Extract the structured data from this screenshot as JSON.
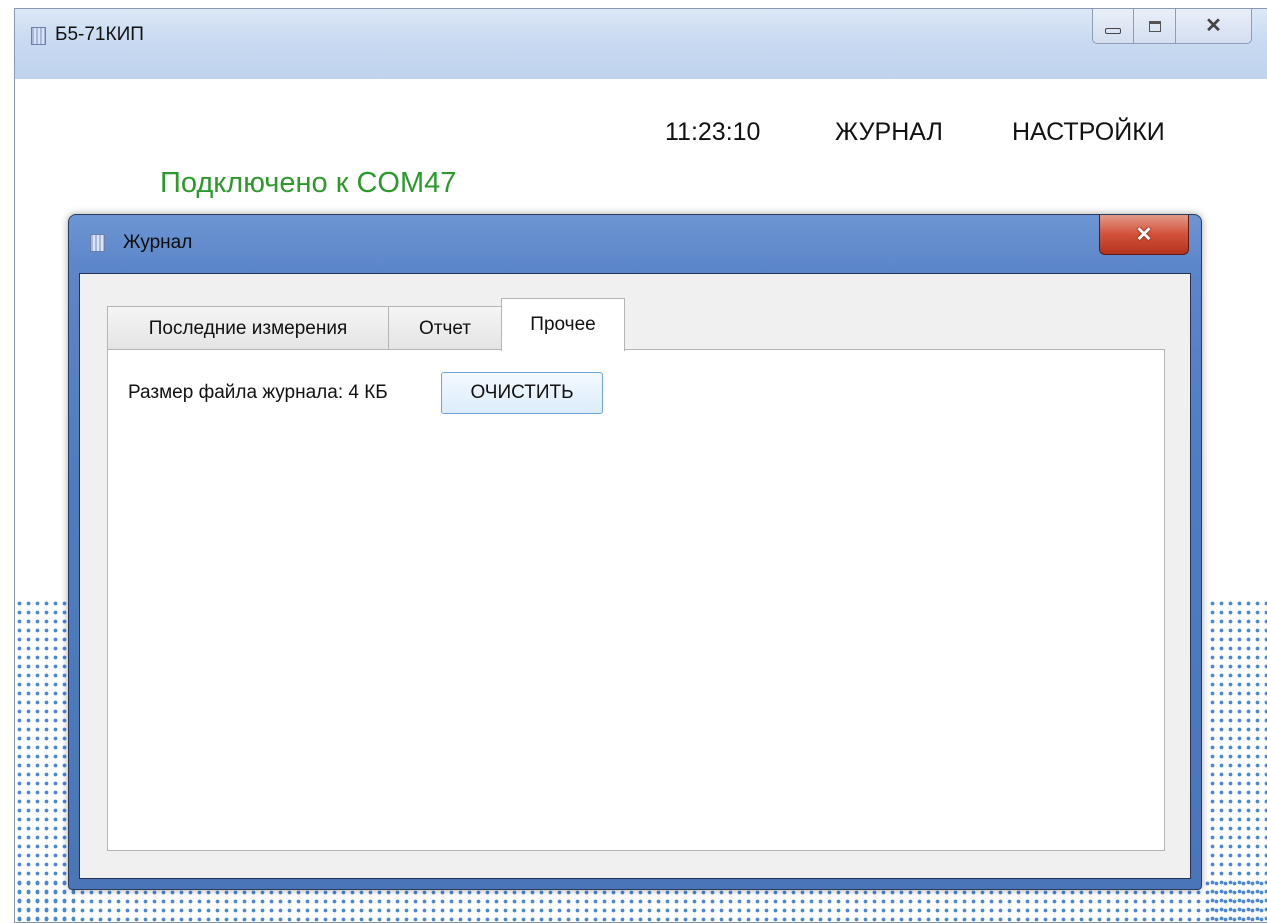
{
  "main_window": {
    "title": "Б5-71КИП",
    "clock": "11:23:10",
    "nav": {
      "journal": "ЖУРНАЛ",
      "settings": "НАСТРОЙКИ"
    },
    "status": "Подключено к COM47",
    "status_color": "#2b9a2b"
  },
  "dialog": {
    "title": "Журнал",
    "tabs": [
      {
        "label": "Последние измерения",
        "active": false
      },
      {
        "label": "Отчет",
        "active": false
      },
      {
        "label": "Прочее",
        "active": true
      }
    ],
    "file_size_label": "Размер файла журнала: 4 КБ",
    "clear_button": "ОЧИСТИТЬ"
  },
  "icons": {
    "app": "app-icon",
    "minimize": "minimize-icon",
    "maximize": "maximize-icon",
    "close": "close-icon"
  }
}
